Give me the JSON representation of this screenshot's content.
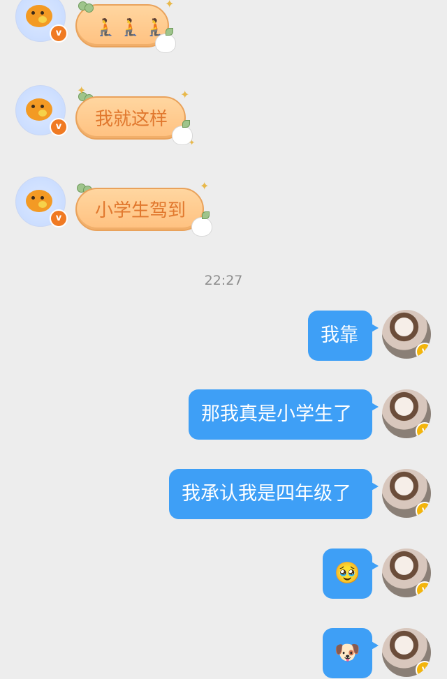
{
  "colors": {
    "background": "#ededed",
    "outgoing_bubble": "#3e9ff6",
    "sticker_bubble": "#ffc990",
    "sticker_text": "#e1782e"
  },
  "incoming": [
    {
      "type": "emoji_sticker",
      "emojis": "🧎🧎🧎"
    },
    {
      "type": "text_sticker",
      "text": "我就这样"
    },
    {
      "type": "text_sticker",
      "text": "小学生驾到"
    }
  ],
  "timestamp": "22:27",
  "outgoing": [
    {
      "text": "我靠"
    },
    {
      "text": "那我真是小学生了"
    },
    {
      "text": "我承认我是四年级了"
    },
    {
      "text": "🥹"
    },
    {
      "text": "🐶"
    }
  ],
  "badge_letter": "v"
}
